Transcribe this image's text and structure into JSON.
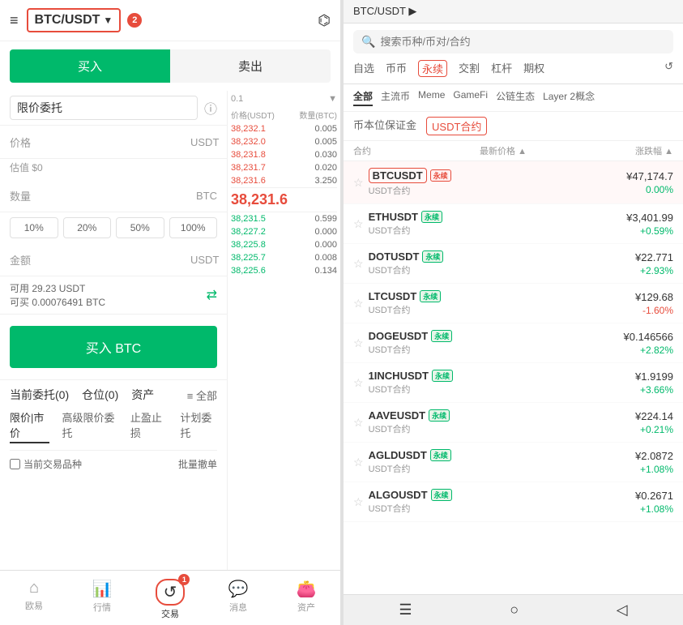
{
  "left": {
    "menu_icon": "≡",
    "pair": "BTC/USDT",
    "badge_2": "2",
    "chart_icon": "⌬",
    "tab_buy": "买入",
    "tab_sell": "卖出",
    "order_type": "限价委托",
    "price_label": "价格",
    "price_unit": "USDT",
    "est_label": "估值 $0",
    "amount_label": "数量",
    "amount_unit": "BTC",
    "pct_btns": [
      "10%",
      "20%",
      "50%",
      "100%"
    ],
    "total_label": "金额",
    "total_unit": "USDT",
    "avail_label": "可用 29.23 USDT",
    "avail_buy": "可买 0.00076491 BTC",
    "buy_btn": "买入 BTC",
    "order_section": {
      "tabs": [
        "当前委托(0)",
        "仓位(0)",
        "资产"
      ],
      "all_btn": "≡ 全部",
      "type_tabs": [
        "限价|市价",
        "高级限价委托",
        "止盈止损",
        "计划委托"
      ],
      "checkbox_label": "当前交易品种",
      "batch_btn": "批量撤单"
    },
    "nav": [
      {
        "icon": "⌂",
        "label": "欧易"
      },
      {
        "icon": "📊",
        "label": "行情"
      },
      {
        "icon": "↺",
        "label": "交易"
      },
      {
        "icon": "💬",
        "label": "消息"
      },
      {
        "icon": "👛",
        "label": "资产"
      }
    ],
    "nav_active_index": 2,
    "badge_1": "1",
    "orderbook": {
      "header_price": "价格(USDT)",
      "header_qty": "数量(BTC)",
      "vol_label": "0.1",
      "asks": [
        {
          "price": "38,232.1",
          "qty": "0.005"
        },
        {
          "price": "38,232.0",
          "qty": "0.005"
        },
        {
          "price": "38,231.8",
          "qty": "0.030"
        },
        {
          "price": "38,231.7",
          "qty": "0.020"
        },
        {
          "price": "38,231.6",
          "qty": "3.250"
        }
      ],
      "current": "38,231.6",
      "bids": [
        {
          "price": "38,231.5",
          "qty": "0.599"
        },
        {
          "price": "38,227.2",
          "qty": "0.000"
        },
        {
          "price": "38,225.8",
          "qty": "0.000"
        },
        {
          "price": "38,225.7",
          "qty": "0.008"
        },
        {
          "price": "38,225.6",
          "qty": "0.134"
        }
      ]
    }
  },
  "right": {
    "top_bar": "BTC/USDT ▶",
    "search_placeholder": "搜索币种/币对/合约",
    "category_tabs": [
      "自选",
      "币币",
      "永续",
      "交割",
      "杠杆",
      "期权"
    ],
    "active_category": "永续",
    "refresh_icon": "↺",
    "sub_tabs": [
      "全部",
      "主流币",
      "Meme",
      "GameFi",
      "公链生态",
      "Layer 2概念"
    ],
    "active_sub": "全部",
    "contract_tabs": [
      "币本位保证金",
      "USDT合约"
    ],
    "active_contract": "USDT合约",
    "list_header_name": "合约",
    "list_header_price": "最新价格 ▲",
    "list_header_change": "涨跌幅 ▲",
    "coins": [
      {
        "name": "BTCUSDT",
        "badge": "永续",
        "badge_color": "red",
        "sub": "USDT合约",
        "price": "¥47,174.7",
        "change": "0.00%",
        "change_type": "neutral",
        "highlighted": true
      },
      {
        "name": "ETHUSDT",
        "badge": "永续",
        "badge_color": "green",
        "sub": "USDT合约",
        "price": "¥3,401.99",
        "change": "+0.59%",
        "change_type": "green"
      },
      {
        "name": "DOTUSDT",
        "badge": "永续",
        "badge_color": "green",
        "sub": "USDT合约",
        "price": "¥22.771",
        "change": "+2.93%",
        "change_type": "green"
      },
      {
        "name": "LTCUSDT",
        "badge": "永续",
        "badge_color": "green",
        "sub": "USDT合约",
        "price": "¥129.68",
        "change": "-1.60%",
        "change_type": "red"
      },
      {
        "name": "DOGEUSDT",
        "badge": "永续",
        "badge_color": "green",
        "sub": "USDT合约",
        "price": "¥0.146566",
        "change": "+2.82%",
        "change_type": "green"
      },
      {
        "name": "1INCHUSDT",
        "badge": "永续",
        "badge_color": "green",
        "sub": "USDT合约",
        "price": "¥1.9199",
        "change": "+3.66%",
        "change_type": "green"
      },
      {
        "name": "AAVEUSDT",
        "badge": "永续",
        "badge_color": "green",
        "sub": "USDT合约",
        "price": "¥224.14",
        "change": "+0.21%",
        "change_type": "green"
      },
      {
        "name": "AGLDUSDT",
        "badge": "永续",
        "badge_color": "green",
        "sub": "USDT合约",
        "price": "¥2.0872",
        "change": "+1.08%",
        "change_type": "green"
      },
      {
        "name": "ALGOUSDT",
        "badge": "永续",
        "badge_color": "green",
        "sub": "USDT合约",
        "price": "¥0.2671",
        "change": "+1.08%",
        "change_type": "green"
      }
    ]
  }
}
